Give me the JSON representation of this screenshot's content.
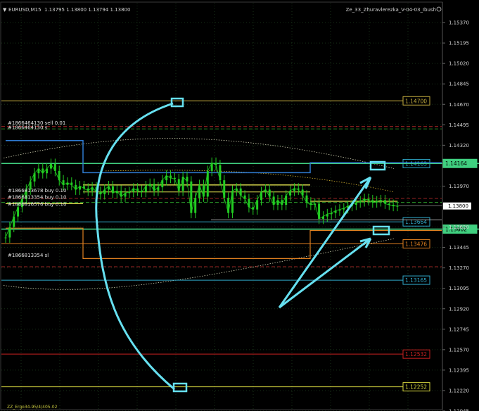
{
  "window": {
    "symbol_title": "EURUSD,M15",
    "ohlc": "1.13795 1.13800 1.13794 1.13800",
    "indicator_title": "Ze_33_Zhuravlerezka_V-04-03_Ibush",
    "bottom_note": "ZZ_Ergo34-95/4/405-02"
  },
  "colors": {
    "background": "#000000",
    "grid": "#1f3a1f",
    "bull": "#22cc22",
    "annotation": "#66e0f0",
    "level_gold": "#c8b040",
    "level_cyan": "#2fa8c8",
    "level_green": "#40d080",
    "level_orange": "#e08020",
    "level_red": "#c82020",
    "level_yellow": "#d8d840"
  },
  "chart_data": {
    "type": "line",
    "ylim": [
      1.12045,
      1.15545
    ],
    "yticks": [
      "1.15370",
      "1.15195",
      "1.15020",
      "1.14845",
      "1.14670",
      "1.14495",
      "1.14320",
      "1.13970",
      "1.13620",
      "1.13445",
      "1.13270",
      "1.13095",
      "1.12920",
      "1.12745",
      "1.12570",
      "1.12395",
      "1.12220",
      "1.12045"
    ],
    "current_price": "1.13800",
    "levels": [
      {
        "label": "1.14700",
        "value": 1.147,
        "color": "#c8b040",
        "style": "solid"
      },
      {
        "label": "1.14163",
        "value": 1.14163,
        "color": "#2fa8c8",
        "style": "solid"
      },
      {
        "label": "1.14164",
        "value": 1.14164,
        "color": "#40d080",
        "style": "solid"
      },
      {
        "label": "1.13664",
        "value": 1.13664,
        "color": "#2fa8c8",
        "style": "solid"
      },
      {
        "label": "1.13602",
        "value": 1.13602,
        "color": "#40d080",
        "style": "solid"
      },
      {
        "label": "1.13476",
        "value": 1.13476,
        "color": "#e08020",
        "style": "solid"
      },
      {
        "label": "1.13165",
        "value": 1.13165,
        "color": "#2fa8c8",
        "style": "solid"
      },
      {
        "label": "1.12532",
        "value": 1.12532,
        "color": "#c82020",
        "style": "solid"
      },
      {
        "label": "1.12252",
        "value": 1.12252,
        "color": "#d8d840",
        "style": "solid"
      }
    ],
    "dashed_levels": [
      {
        "value": 1.1448,
        "color": "#d03030"
      },
      {
        "value": 1.1446,
        "color": "#30b030"
      },
      {
        "value": 1.13865,
        "color": "#d03030"
      },
      {
        "value": 1.1383,
        "color": "#30b030"
      },
      {
        "value": 1.1328,
        "color": "#d03030"
      }
    ],
    "orders": [
      {
        "label": "#1866464130 sell 0.01",
        "value": 1.14512
      },
      {
        "label": "#1866464130 s",
        "value": 1.14472
      },
      {
        "label": "#1866813678 buy 0.10",
        "value": 1.13935
      },
      {
        "label": "#1866813354 buy 0.10",
        "value": 1.13875
      },
      {
        "label": "#1866816576 buy 0.10",
        "value": 1.13815
      },
      {
        "label": "#1866813354 sl",
        "value": 1.1338
      }
    ],
    "series": [
      {
        "values": [
          1.1353,
          1.1362,
          1.1371,
          1.1379,
          1.1386,
          1.1394,
          1.1401,
          1.1408,
          1.1412,
          1.1408,
          1.1412,
          1.1416,
          1.141,
          1.1402,
          1.1398,
          1.14,
          1.1398,
          1.1394,
          1.1397,
          1.1395,
          1.1393,
          1.1396,
          1.1392,
          1.139,
          1.1394,
          1.1397,
          1.1391,
          1.1393,
          1.1388,
          1.1391,
          1.1392,
          1.1395,
          1.1393,
          1.1392,
          1.1397,
          1.1399,
          1.1393,
          1.1396,
          1.1402,
          1.1406,
          1.1404,
          1.1403,
          1.1393,
          1.1405,
          1.1401,
          1.1374,
          1.1387,
          1.1398,
          1.1388,
          1.141,
          1.1417,
          1.1415,
          1.1402,
          1.1387,
          1.1374,
          1.1393,
          1.1395,
          1.1389,
          1.1386,
          1.1379,
          1.1377,
          1.1385,
          1.1392,
          1.1394,
          1.1388,
          1.1381,
          1.1385,
          1.1381,
          1.1389,
          1.1393,
          1.1395,
          1.1394,
          1.1389,
          1.1383,
          1.1381,
          1.1382,
          1.1369,
          1.1371,
          1.1373,
          1.1374,
          1.1376,
          1.1377,
          1.1378,
          1.138,
          1.1381,
          1.1383,
          1.1384,
          1.1386,
          1.1385,
          1.1383,
          1.1384,
          1.1385,
          1.1382,
          1.1381,
          1.138,
          1.138
        ]
      }
    ]
  }
}
